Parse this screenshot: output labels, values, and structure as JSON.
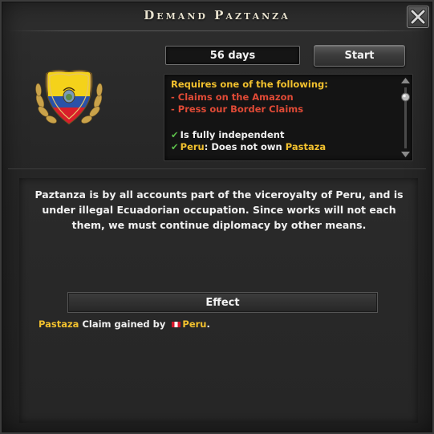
{
  "window": {
    "title": "Demand Paztanza",
    "close_label": "close"
  },
  "timer": {
    "duration": "56 days",
    "start_label": "Start"
  },
  "emblem": {
    "icon": "ecuador-flag-shield-icon",
    "colors": [
      "#f4d21a",
      "#2a52a8",
      "#d81e2a"
    ]
  },
  "requirements": {
    "header": "Requires one of the following:",
    "options": [
      "- Claims on the Amazon",
      "- Press our Border Claims"
    ],
    "conditions": [
      {
        "text": "Is fully independent",
        "status": "met"
      },
      {
        "country": "Peru",
        "text": ": Does not own ",
        "province": "Pastaza",
        "status": "met"
      }
    ]
  },
  "description": "Paztanza is by all accounts part of the viceroyalty of Peru, and is under illegal Ecuadorian occupation. Since works will not each them, we must continue diplomacy by other means.",
  "effect": {
    "header": "Effect",
    "province": "Pastaza",
    "text": " Claim gained by ",
    "country": "Peru",
    "end": "."
  }
}
